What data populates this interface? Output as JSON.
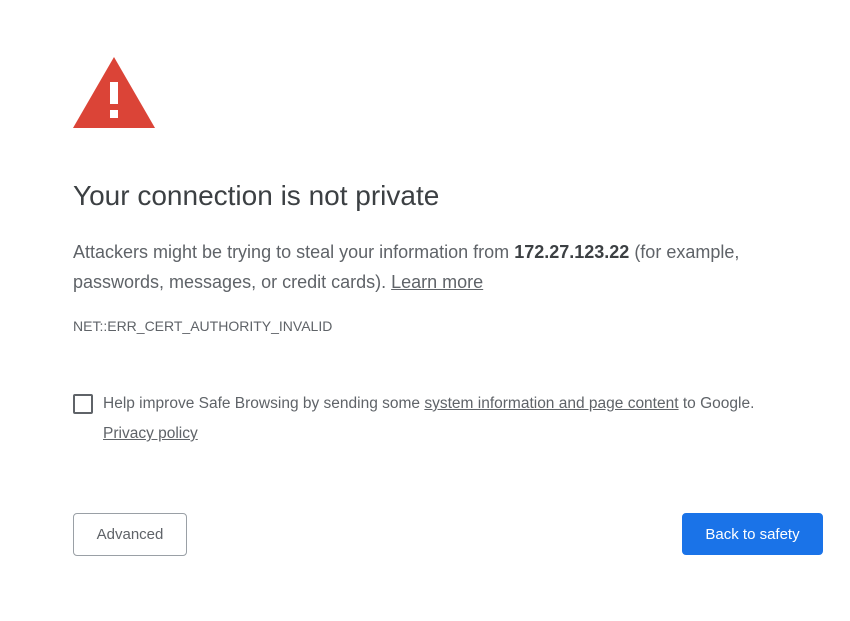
{
  "icon": {
    "name": "warning-triangle-icon",
    "color": "#db4437"
  },
  "heading": "Your connection is not private",
  "message": {
    "prefix": "Attackers might be trying to steal your information from ",
    "host": "172.27.123.22",
    "suffix": " (for example, passwords, messages, or credit cards). ",
    "learn_more": "Learn more"
  },
  "error_code": "NET::ERR_CERT_AUTHORITY_INVALID",
  "safe_browsing": {
    "checked": false,
    "text_prefix": "Help improve Safe Browsing by sending some ",
    "link_text": "system information and page content",
    "text_suffix": " to Google.",
    "privacy_link": "Privacy policy"
  },
  "buttons": {
    "advanced": "Advanced",
    "back_to_safety": "Back to safety"
  },
  "colors": {
    "primary_button": "#1a73e8",
    "text": "#5f6368",
    "heading": "#3c4043"
  }
}
